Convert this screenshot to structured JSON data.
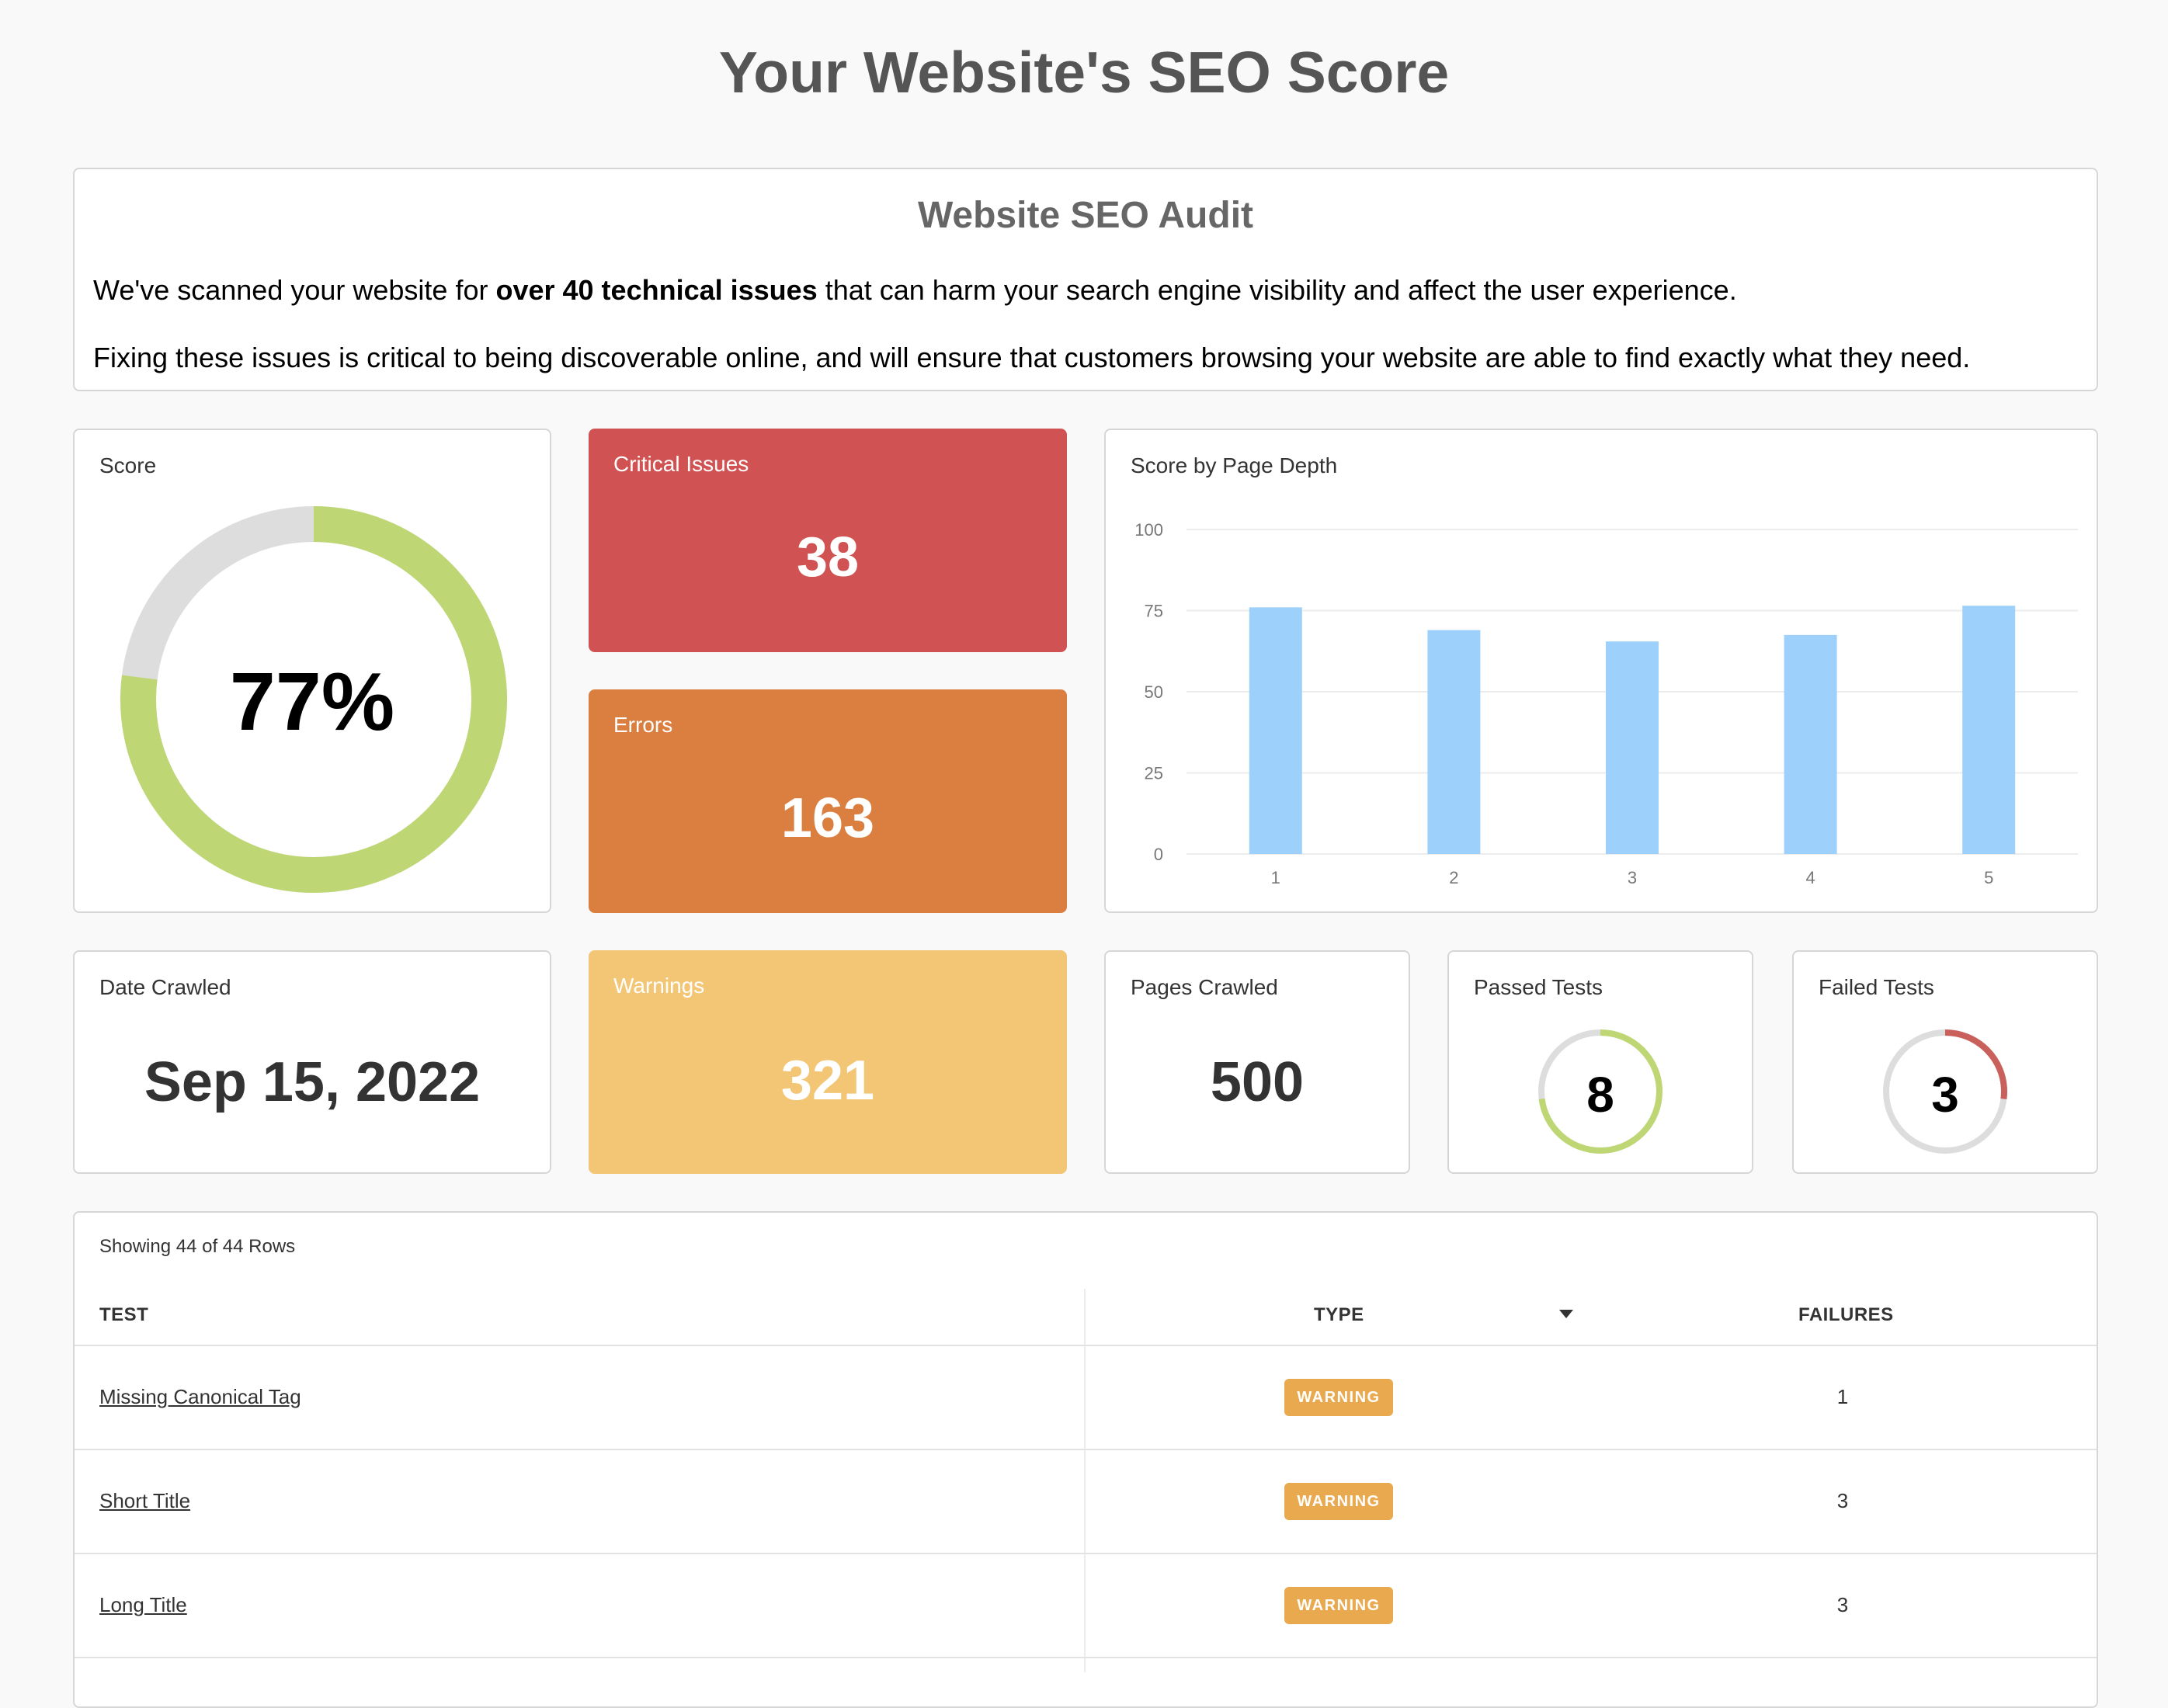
{
  "page": {
    "title": "Your Website's SEO Score"
  },
  "intro": {
    "title": "Website SEO Audit",
    "p1_before": "We've scanned your website for ",
    "p1_bold": "over 40 technical issues",
    "p1_after": " that can harm your search engine visibility and affect the user experience.",
    "p2": "Fixing these issues is critical to being discoverable online, and will ensure that customers browsing your website are able to find exactly what they need."
  },
  "score": {
    "label": "Score",
    "value_text": "77%",
    "percent": 77,
    "fill_color": "#bed774",
    "track_color": "#dddddd"
  },
  "critical": {
    "label": "Critical Issues",
    "value": "38",
    "color": "#d05252"
  },
  "errors": {
    "label": "Errors",
    "value": "163",
    "color": "#da7f40"
  },
  "warnings": {
    "label": "Warnings",
    "value": "321",
    "color": "#f2c675"
  },
  "date_crawled": {
    "label": "Date Crawled",
    "value": "Sep 15, 2022"
  },
  "pages_crawled": {
    "label": "Pages Crawled",
    "value": "500"
  },
  "passed_tests": {
    "label": "Passed Tests",
    "value": "8",
    "fraction": 0.73,
    "color": "#bed774"
  },
  "failed_tests": {
    "label": "Failed Tests",
    "value": "3",
    "fraction": 0.27,
    "color": "#c9605c"
  },
  "chart_data": {
    "type": "bar",
    "title": "Score by Page Depth",
    "categories": [
      "1",
      "2",
      "3",
      "4",
      "5"
    ],
    "values": [
      76,
      69,
      65.5,
      67.5,
      76.5
    ],
    "ylim": [
      0,
      100
    ],
    "yticks": [
      "0",
      "25",
      "50",
      "75",
      "100"
    ],
    "grid": true,
    "bar_color": "#9dd0fa"
  },
  "table": {
    "rows_note": "Showing 44 of 44 Rows",
    "headers": {
      "test": "TEST",
      "type": "TYPE",
      "failures": "FAILURES"
    },
    "rows": [
      {
        "test": "Missing Canonical Tag",
        "type": "WARNING",
        "failures": "1"
      },
      {
        "test": "Short Title",
        "type": "WARNING",
        "failures": "3"
      },
      {
        "test": "Long Title",
        "type": "WARNING",
        "failures": "3"
      }
    ]
  }
}
